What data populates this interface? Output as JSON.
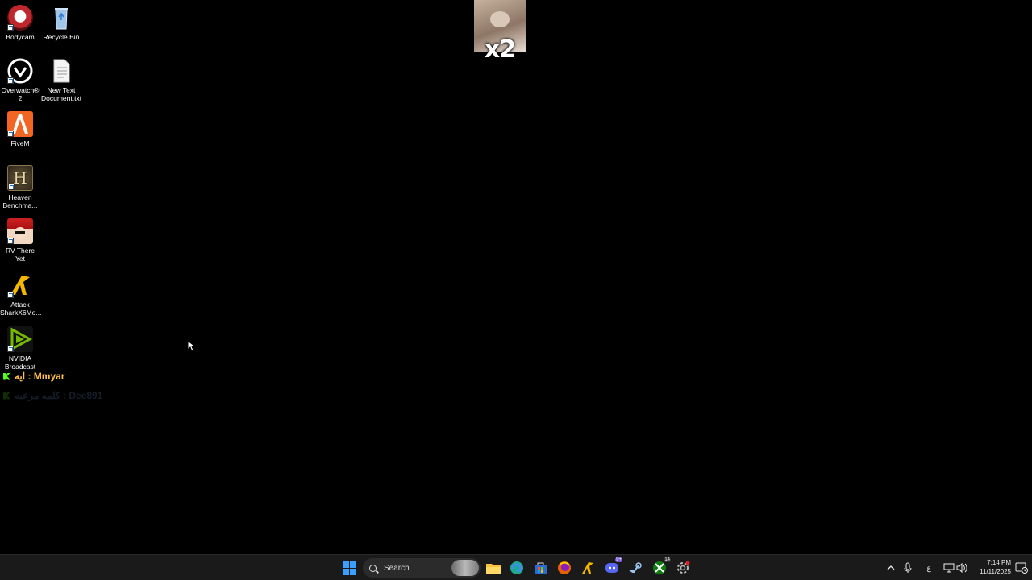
{
  "desktop": {
    "icons": [
      {
        "label": "Bodycam",
        "icon": "bodycam-icon"
      },
      {
        "label": "Recycle Bin",
        "icon": "recycle-bin-icon"
      },
      {
        "label": "Overwatch® 2",
        "icon": "overwatch-icon"
      },
      {
        "label": "New Text Document.txt",
        "icon": "text-document-icon"
      },
      {
        "label": "FiveM",
        "icon": "fivem-icon"
      },
      {
        "label": "Heaven Benchma...",
        "icon": "heaven-benchmark-icon"
      },
      {
        "label": "RV There Yet",
        "icon": "rv-there-yet-icon"
      },
      {
        "label": "Attack SharkX6Mo...",
        "icon": "attack-shark-icon"
      },
      {
        "label": "NVIDIA Broadcast",
        "icon": "nvidia-broadcast-icon"
      }
    ]
  },
  "overlay": {
    "multiplier": "x2"
  },
  "chat": [
    {
      "text": "ايه : Mmyar"
    },
    {
      "text": "كلمه مرعبه : Dee891"
    }
  ],
  "taskbar": {
    "search_label": "Search",
    "apps": [
      "windows-start-icon",
      "file-explorer-icon",
      "edge-icon",
      "store-icon",
      "firefox-icon",
      "attack-shark-icon",
      "discord-icon",
      "steam-icon",
      "xbox-icon",
      "settings-icon"
    ],
    "discord_badge": "9+",
    "xbox_badge": "14",
    "tray": {
      "language": "ع",
      "time": "7:14 PM",
      "date": "11/11/2025"
    }
  },
  "colors": {
    "taskbar_bg": "#1a1a1a",
    "kick_green": "#53fc18",
    "chat_name": "#ffc04d"
  }
}
